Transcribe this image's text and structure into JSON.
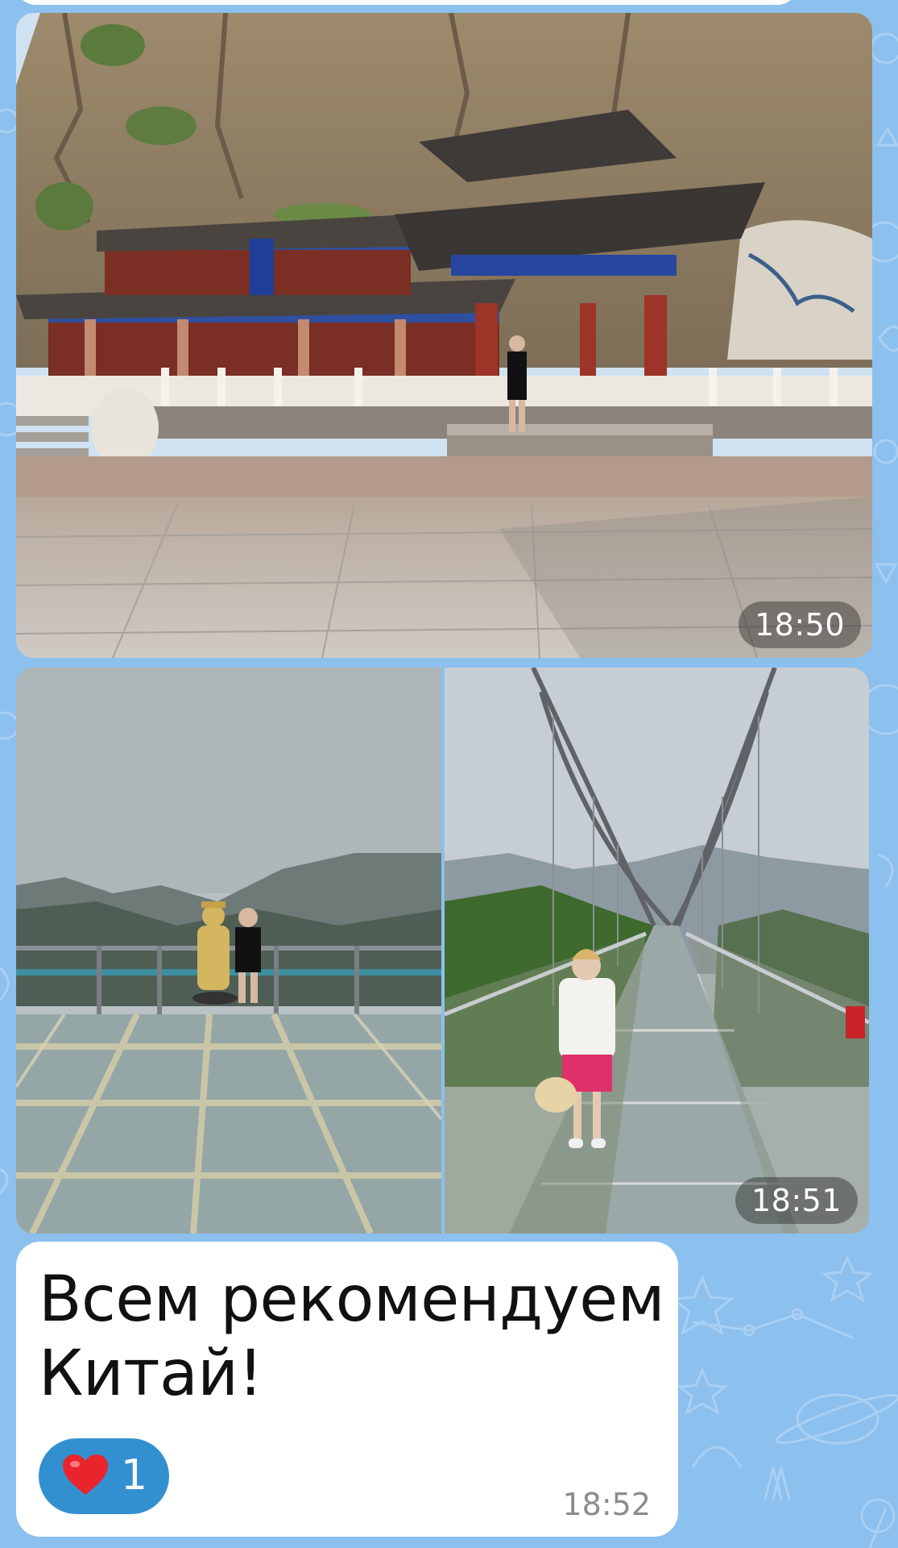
{
  "chat": {
    "background_color": "#8cc0ee",
    "messages": [
      {
        "type": "photo",
        "time": "18:50",
        "photo_subject": "temple-pavilion-at-cliff"
      },
      {
        "type": "photo-album",
        "time": "18:51",
        "photos": [
          {
            "photo_subject": "glass-skywalk-observation-deck"
          },
          {
            "photo_subject": "glass-suspension-bridge"
          }
        ]
      },
      {
        "type": "text",
        "text": "Всем рекомендуем Китай!",
        "time": "18:52",
        "reaction": {
          "emoji": "❤️",
          "icon": "heart-icon",
          "count": "1",
          "color": "#3390d0"
        }
      }
    ]
  }
}
